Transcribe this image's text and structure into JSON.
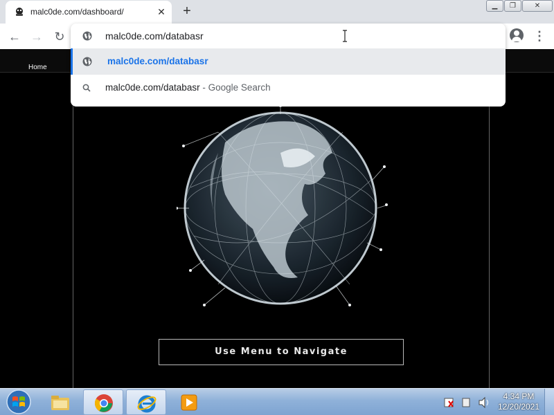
{
  "browser": {
    "tab": {
      "title": "malc0de.com/dashboard/",
      "favicon": "malware-site-icon",
      "close": "✕"
    },
    "new_tab_label": "+",
    "window_controls": {
      "minimize": "▁",
      "restore": "❐",
      "close": "✕"
    },
    "nav": {
      "back": "←",
      "forward": "→",
      "reload": "↻"
    },
    "omnibox": {
      "input_value": "malc0de.com/databasr",
      "suggestions": [
        {
          "text": "malc0de.com/databasr",
          "suffix": "",
          "icon": "globe-icon"
        },
        {
          "text": "malc0de.com/databasr",
          "suffix": " - Google Search",
          "icon": "search-icon"
        }
      ]
    },
    "menu_icon": "⋮"
  },
  "site": {
    "nav": {
      "home": "Home"
    },
    "cta": "Use Menu to Navigate"
  },
  "taskbar": {
    "clock": {
      "time": "4:34 PM",
      "date": "12/20/2021"
    },
    "apps": [
      "file-explorer-icon",
      "chrome-icon",
      "internet-explorer-icon",
      "media-player-icon"
    ]
  },
  "colors": {
    "accent": "#1a73e8",
    "taskbar": "#8fb1d9",
    "page_bg": "#000000"
  }
}
